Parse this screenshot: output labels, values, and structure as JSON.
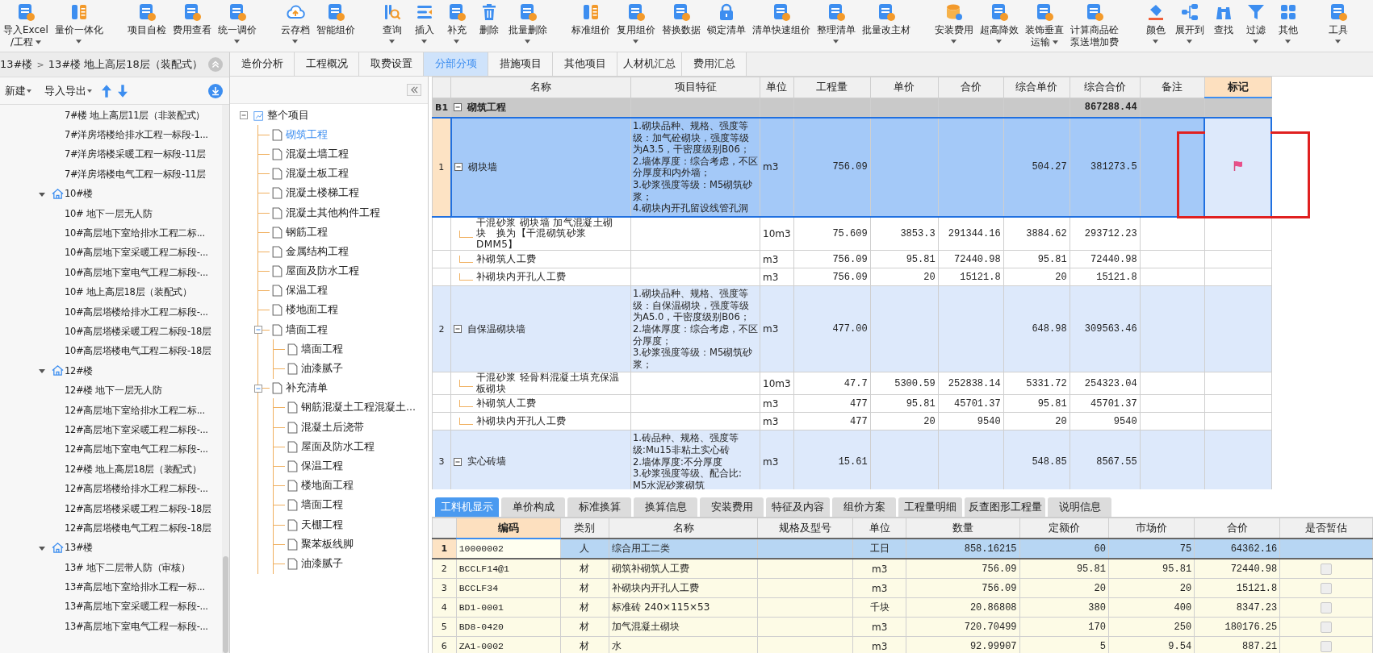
{
  "toolbar": {
    "groups": [
      {
        "items": [
          {
            "lines": [
              "导入Excel",
              "/工程"
            ],
            "dropdown": true
          },
          {
            "lines": [
              "量价一体化"
            ],
            "dropdown": true
          }
        ]
      },
      {
        "items": [
          {
            "lines": [
              "项目自检"
            ],
            "dropdown": false
          },
          {
            "lines": [
              "费用查看"
            ],
            "dropdown": false
          },
          {
            "lines": [
              "统一调价"
            ],
            "dropdown": true
          }
        ]
      },
      {
        "items": [
          {
            "lines": [
              "云存档"
            ],
            "dropdown": true
          },
          {
            "lines": [
              "智能组价"
            ],
            "dropdown": false
          }
        ]
      },
      {
        "items": [
          {
            "lines": [
              "查询"
            ],
            "dropdown": true
          },
          {
            "lines": [
              "插入"
            ],
            "dropdown": true
          },
          {
            "lines": [
              "补充"
            ],
            "dropdown": true
          },
          {
            "lines": [
              "删除"
            ],
            "dropdown": false
          },
          {
            "lines": [
              "批量删除"
            ],
            "dropdown": true
          }
        ]
      },
      {
        "items": [
          {
            "lines": [
              "标准组价"
            ],
            "dropdown": false
          },
          {
            "lines": [
              "复用组价"
            ],
            "dropdown": true
          },
          {
            "lines": [
              "替换数据"
            ],
            "dropdown": false
          },
          {
            "lines": [
              "锁定清单"
            ],
            "dropdown": false
          },
          {
            "lines": [
              "清单快速组价"
            ],
            "dropdown": false
          },
          {
            "lines": [
              "整理清单"
            ],
            "dropdown": true
          },
          {
            "lines": [
              "批量改主材"
            ],
            "dropdown": false
          }
        ]
      },
      {
        "items": [
          {
            "lines": [
              "安装费用"
            ],
            "dropdown": true
          },
          {
            "lines": [
              "超高降效"
            ],
            "dropdown": true
          },
          {
            "lines": [
              "装饰垂直",
              "运输"
            ],
            "dropdown": true
          },
          {
            "lines": [
              "计算商品砼",
              "泵送增加费"
            ],
            "dropdown": false
          }
        ]
      },
      {
        "items": [
          {
            "lines": [
              "颜色"
            ],
            "dropdown": true
          },
          {
            "lines": [
              "展开到"
            ],
            "dropdown": true
          },
          {
            "lines": [
              "查找"
            ],
            "dropdown": false
          },
          {
            "lines": [
              "过滤"
            ],
            "dropdown": true
          },
          {
            "lines": [
              "其他"
            ],
            "dropdown": true
          }
        ]
      },
      {
        "items": [
          {
            "lines": [
              "工具"
            ],
            "dropdown": true
          }
        ]
      }
    ]
  },
  "breadcrumb": {
    "parts": [
      "13#楼",
      "13#楼 地上高层18层（装配式）"
    ],
    "separator": ">"
  },
  "left_toolbar": {
    "new": "新建",
    "import_export": "导入导出"
  },
  "project_tree": [
    {
      "label": "7#楼 地上高层11层（非装配式）"
    },
    {
      "label": "7#洋房塔楼给排水工程一标段-1..."
    },
    {
      "label": "7#洋房塔楼采暖工程一标段-11层"
    },
    {
      "label": "7#洋房塔楼电气工程一标段-11层"
    },
    {
      "label": "10#楼",
      "expanded": true,
      "children": [
        {
          "label": "10# 地下一层无人防"
        },
        {
          "label": "10#高层地下室给排水工程二标..."
        },
        {
          "label": "10#高层地下室采暖工程二标段-..."
        },
        {
          "label": "10#高层地下室电气工程二标段-..."
        },
        {
          "label": "10# 地上高层18层（装配式）"
        },
        {
          "label": "10#高层塔楼给排水工程二标段-..."
        },
        {
          "label": "10#高层塔楼采暖工程二标段-18层"
        },
        {
          "label": "10#高层塔楼电气工程二标段-18层"
        }
      ]
    },
    {
      "label": "12#楼",
      "expanded": true,
      "children": [
        {
          "label": "12#楼 地下一层无人防"
        },
        {
          "label": "12#高层地下室给排水工程二标..."
        },
        {
          "label": "12#高层地下室采暖工程二标段-..."
        },
        {
          "label": "12#高层地下室电气工程二标段-..."
        },
        {
          "label": "12#楼 地上高层18层（装配式）"
        },
        {
          "label": "12#高层塔楼给排水工程二标段-..."
        },
        {
          "label": "12#高层塔楼采暖工程二标段-18层"
        },
        {
          "label": "12#高层塔楼电气工程二标段-18层"
        }
      ]
    },
    {
      "label": "13#楼",
      "expanded": true,
      "children": [
        {
          "label": "13# 地下二层带人防（审核）"
        },
        {
          "label": "13#高层地下室给排水工程一标..."
        },
        {
          "label": "13#高层地下室采暖工程一标段-..."
        },
        {
          "label": "13#高层地下室电气工程一标段-..."
        }
      ]
    }
  ],
  "tabs": [
    {
      "label": "造价分析",
      "selected": false
    },
    {
      "label": "工程概况",
      "selected": false
    },
    {
      "label": "取费设置",
      "selected": false
    },
    {
      "label": "分部分项",
      "selected": true
    },
    {
      "label": "措施项目",
      "selected": false
    },
    {
      "label": "其他项目",
      "selected": false
    },
    {
      "label": "人材机汇总",
      "selected": false
    },
    {
      "label": "费用汇总",
      "selected": false
    }
  ],
  "section_tree": {
    "label": "整个项目",
    "expanded": true,
    "selected": false,
    "children": [
      {
        "label": "砌筑工程",
        "selected": true
      },
      {
        "label": "混凝土墙工程",
        "selected": false
      },
      {
        "label": "混凝土板工程",
        "selected": false
      },
      {
        "label": "混凝土楼梯工程",
        "selected": false
      },
      {
        "label": "混凝土其他构件工程",
        "selected": false
      },
      {
        "label": "钢筋工程",
        "selected": false
      },
      {
        "label": "金属结构工程",
        "selected": false
      },
      {
        "label": "屋面及防水工程",
        "selected": false
      },
      {
        "label": "保温工程",
        "selected": false
      },
      {
        "label": "楼地面工程",
        "selected": false
      },
      {
        "label": "墙面工程",
        "selected": false,
        "expanded": true,
        "children": [
          {
            "label": "墙面工程",
            "selected": false
          },
          {
            "label": "油漆腻子",
            "selected": false
          }
        ]
      },
      {
        "label": "补充清单",
        "selected": false,
        "expanded": true,
        "children": [
          {
            "label": "钢筋混凝土工程混凝土...",
            "selected": false
          },
          {
            "label": "混凝土后浇带",
            "selected": false
          },
          {
            "label": "屋面及防水工程",
            "selected": false
          },
          {
            "label": "保温工程",
            "selected": false
          },
          {
            "label": "楼地面工程",
            "selected": false
          },
          {
            "label": "墙面工程",
            "selected": false
          },
          {
            "label": "天棚工程",
            "selected": false
          },
          {
            "label": "聚苯板线脚",
            "selected": false
          },
          {
            "label": "油漆腻子",
            "selected": false
          }
        ]
      }
    ]
  },
  "table": {
    "columns": [
      {
        "label": "名称",
        "selected": false
      },
      {
        "label": "项目特征",
        "selected": false
      },
      {
        "label": "单位",
        "selected": false
      },
      {
        "label": "工程量",
        "selected": false
      },
      {
        "label": "单价",
        "selected": false
      },
      {
        "label": "合价",
        "selected": false
      },
      {
        "label": "综合单价",
        "selected": false
      },
      {
        "label": "综合合价",
        "selected": false
      },
      {
        "label": "备注",
        "selected": false
      },
      {
        "label": "标记",
        "selected": true
      }
    ],
    "section": {
      "index": "B1",
      "name": "砌筑工程",
      "expanded": true,
      "comp_total": "867288.44"
    },
    "rows": [
      {
        "index": "1",
        "name": "砌块墙",
        "features": "1.砌块品种、规格、强度等级：加气砼砌块，强度等级为A3.5，干密度级别B06；\n2.墙体厚度：综合考虑，不区分厚度和内外墙；\n3.砂浆强度等级：M5砌筑砂浆；\n4.砌块内开孔留设线管孔洞",
        "unit": "m3",
        "qty": "756.09",
        "comp_price": "504.27",
        "comp_total": "381273.5",
        "selected": true,
        "flagged": true,
        "expanded": true,
        "children": [
          {
            "name": "干混砂浆 砌块墙 加气混凝土砌块　换为【干混砌筑砂浆 DMM5】",
            "unit": "10m3",
            "qty": "75.609",
            "price": "3853.3",
            "total": "291344.16",
            "comp_price": "3884.62",
            "comp_total": "293712.23"
          },
          {
            "name": "补砌筑人工费",
            "unit": "m3",
            "qty": "756.09",
            "price": "95.81",
            "total": "72440.98",
            "comp_price": "95.81",
            "comp_total": "72440.98"
          },
          {
            "name": "补砌块内开孔人工费",
            "unit": "m3",
            "qty": "756.09",
            "price": "20",
            "total": "15121.8",
            "comp_price": "20",
            "comp_total": "15121.8"
          }
        ]
      },
      {
        "index": "2",
        "name": "自保温砌块墙",
        "features": "1.砌块品种、规格、强度等级：自保温砌块，强度等级为A5.0，干密度级别B06；\n2.墙体厚度：综合考虑，不区分厚度；\n3.砂浆强度等级：M5砌筑砂浆；",
        "unit": "m3",
        "qty": "477.00",
        "comp_price": "648.98",
        "comp_total": "309563.46",
        "selected": false,
        "flagged": false,
        "expanded": true,
        "children": [
          {
            "name": "干混砂浆 轻骨料混凝土填充保温板砌块",
            "unit": "10m3",
            "qty": "47.7",
            "price": "5300.59",
            "total": "252838.14",
            "comp_price": "5331.72",
            "comp_total": "254323.04"
          },
          {
            "name": "补砌筑人工费",
            "unit": "m3",
            "qty": "477",
            "price": "95.81",
            "total": "45701.37",
            "comp_price": "95.81",
            "comp_total": "45701.37"
          },
          {
            "name": "补砌块内开孔人工费",
            "unit": "m3",
            "qty": "477",
            "price": "20",
            "total": "9540",
            "comp_price": "20",
            "comp_total": "9540"
          }
        ]
      },
      {
        "index": "3",
        "name": "实心砖墙",
        "features": "1.砖品种、规格、强度等级:Mu15非粘土实心砖\n2.墙体厚度:不分厚度\n3.砂浆强度等级、配合比: M5水泥砂浆砌筑",
        "unit": "m3",
        "qty": "15.61",
        "comp_price": "548.85",
        "comp_total": "8567.55",
        "selected": false,
        "flagged": false,
        "expanded": true
      }
    ]
  },
  "bottom_tabs": [
    {
      "label": "工料机显示",
      "selected": true
    },
    {
      "label": "单价构成",
      "selected": false
    },
    {
      "label": "标准换算",
      "selected": false
    },
    {
      "label": "换算信息",
      "selected": false
    },
    {
      "label": "安装费用",
      "selected": false
    },
    {
      "label": "特征及内容",
      "selected": false
    },
    {
      "label": "组价方案",
      "selected": false
    },
    {
      "label": "工程量明细",
      "selected": false
    },
    {
      "label": "反查图形工程量",
      "selected": false
    },
    {
      "label": "说明信息",
      "selected": false
    }
  ],
  "bottom": {
    "columns": [
      {
        "label": "编码",
        "selected": true
      },
      {
        "label": "类别",
        "selected": false
      },
      {
        "label": "名称",
        "selected": false
      },
      {
        "label": "规格及型号",
        "selected": false
      },
      {
        "label": "单位",
        "selected": false
      },
      {
        "label": "数量",
        "selected": false
      },
      {
        "label": "定额价",
        "selected": false
      },
      {
        "label": "市场价",
        "selected": false
      },
      {
        "label": "合价",
        "selected": false
      },
      {
        "label": "是否暂估",
        "selected": false
      }
    ],
    "rows": [
      {
        "index": "1",
        "code": "10000002",
        "category": "人",
        "name": "综合用工二类",
        "unit": "工日",
        "qty": "858.16215",
        "quota_price": "60",
        "market_price": "75",
        "total": "64362.16",
        "selected": true
      },
      {
        "index": "2",
        "code": "BCCLF14@1",
        "category": "材",
        "name": "砌筑补砌筑人工费",
        "unit": "m3",
        "qty": "756.09",
        "quota_price": "95.81",
        "market_price": "95.81",
        "total": "72440.98",
        "selected": false,
        "checked": false
      },
      {
        "index": "3",
        "code": "BCCLF34",
        "category": "材",
        "name": "补砌块内开孔人工费",
        "unit": "m3",
        "qty": "756.09",
        "quota_price": "20",
        "market_price": "20",
        "total": "15121.8",
        "selected": false,
        "checked": false
      },
      {
        "index": "4",
        "code": "BD1-0001",
        "category": "材",
        "name": "标准砖 240×115×53",
        "unit": "千块",
        "qty": "20.86808",
        "quota_price": "380",
        "market_price": "400",
        "total": "8347.23",
        "selected": false,
        "checked": false
      },
      {
        "index": "5",
        "code": "BD8-0420",
        "category": "材",
        "name": "加气混凝土砌块",
        "unit": "m3",
        "qty": "720.70499",
        "quota_price": "170",
        "market_price": "250",
        "total": "180176.25",
        "selected": false,
        "checked": false
      },
      {
        "index": "6",
        "code": "ZA1-0002",
        "category": "材",
        "name": "水",
        "unit": "m3",
        "qty": "92.99907",
        "quota_price": "5",
        "market_price": "9.54",
        "total": "887.21",
        "selected": false,
        "checked": false
      }
    ]
  }
}
